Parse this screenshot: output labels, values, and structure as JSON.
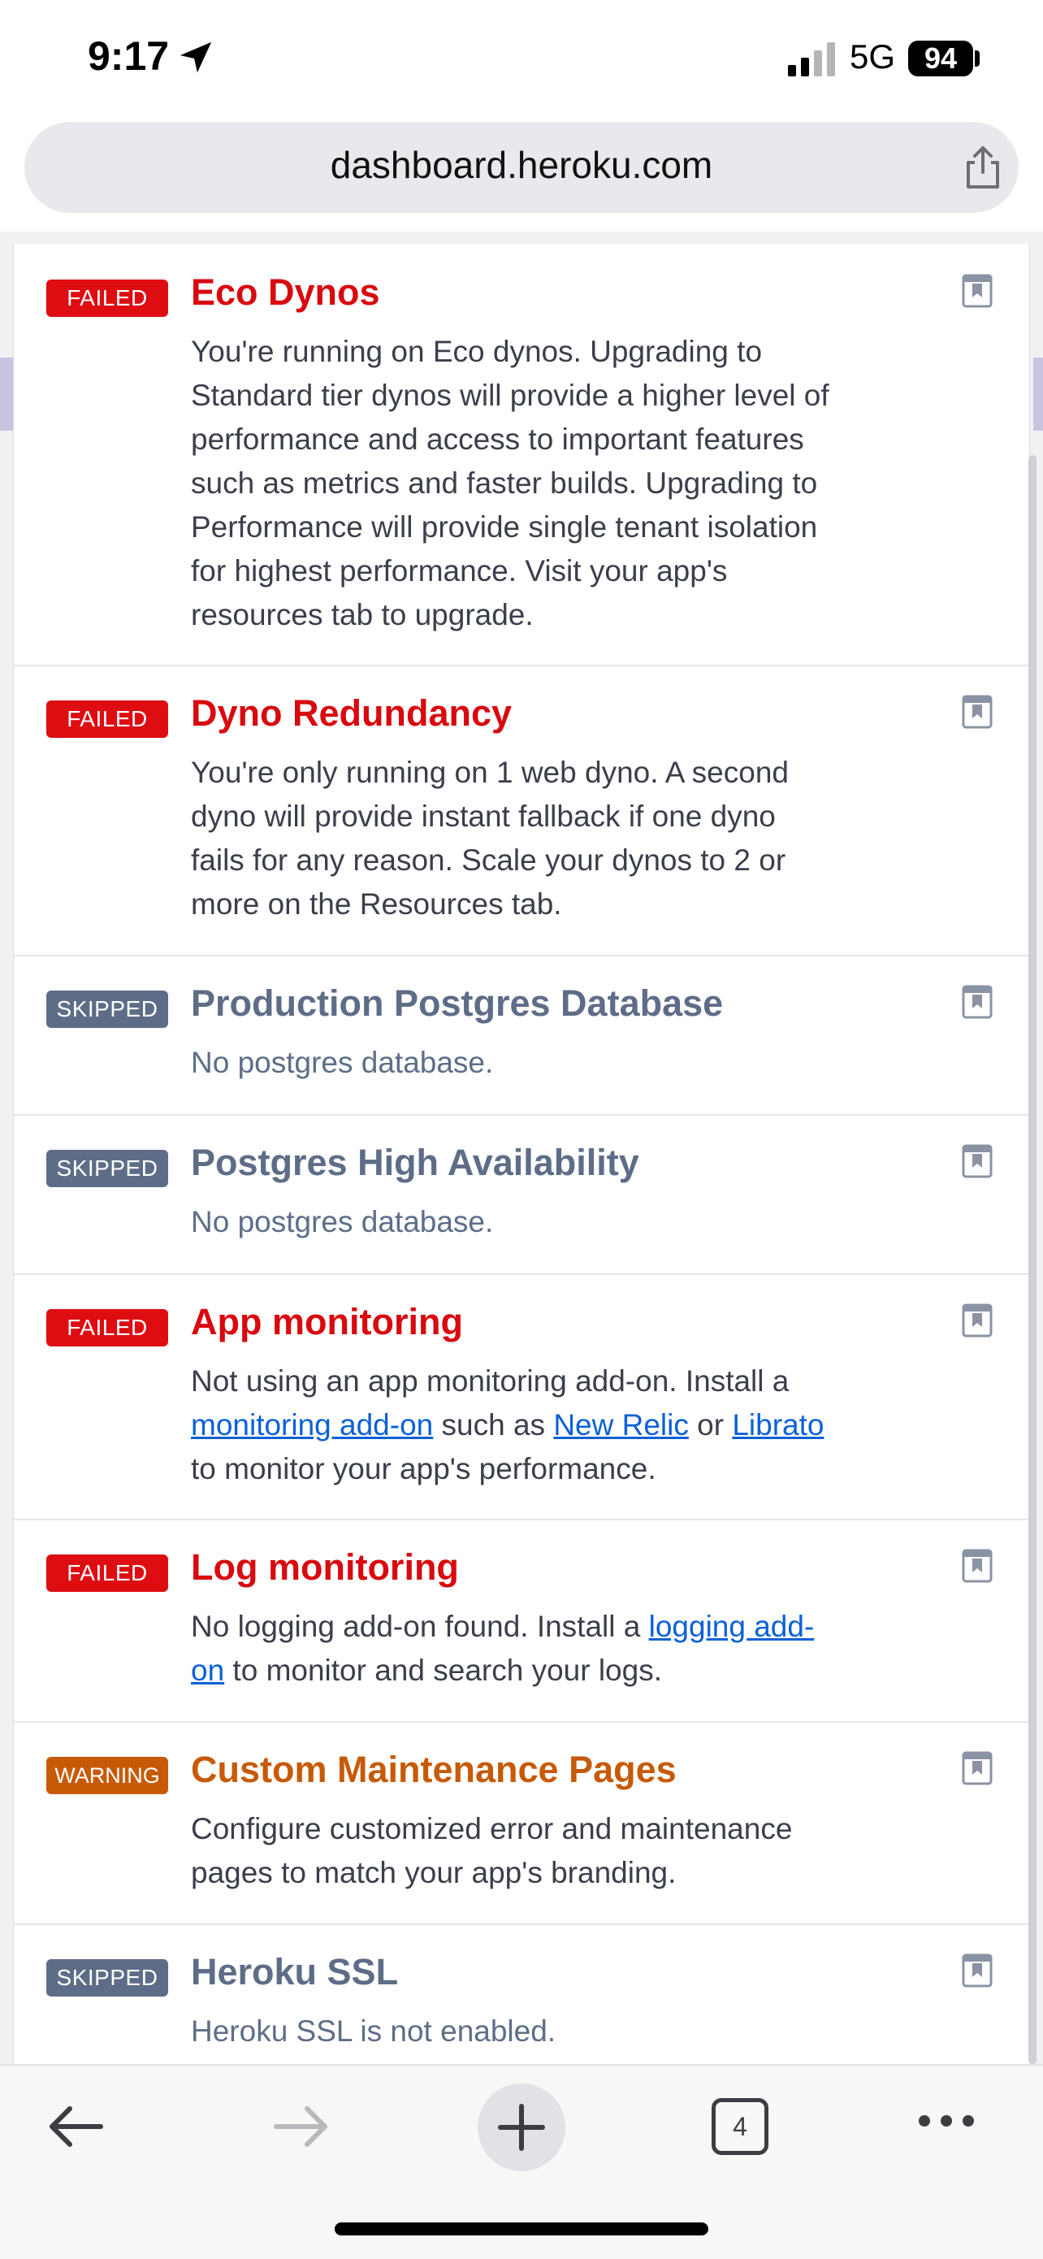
{
  "status_bar": {
    "time": "9:17",
    "network": "5G",
    "battery": "94"
  },
  "browser": {
    "url": "dashboard.heroku.com",
    "tab_count": "4"
  },
  "checks": [
    {
      "status": "FAILED",
      "title": "Eco Dynos",
      "lines": [
        "You're running on Eco dynos. Upgrading to",
        "Standard tier dynos will provide a higher level of",
        "performance and access to important features",
        "such as metrics and faster builds. Upgrading to",
        "Performance will provide single tenant isolation",
        "for highest performance. Visit your app's",
        "resources tab to upgrade."
      ]
    },
    {
      "status": "FAILED",
      "title": "Dyno Redundancy",
      "lines": [
        "You're only running on 1 web dyno. A second",
        "dyno will provide instant fallback if one dyno",
        "fails for any reason. Scale your dynos to 2 or",
        "more on the Resources tab."
      ]
    },
    {
      "status": "SKIPPED",
      "title": "Production Postgres Database",
      "lines": [
        "No postgres database."
      ]
    },
    {
      "status": "SKIPPED",
      "title": "Postgres High Availability",
      "lines": [
        "No postgres database."
      ]
    },
    {
      "status": "FAILED",
      "title": "App monitoring",
      "line1": "Not using an app monitoring add-on. Install a",
      "link1": "monitoring add-on",
      "text2": " such as ",
      "link2": "New Relic",
      "text3": " or ",
      "link3": "Librato",
      "line3": "to monitor your app's performance."
    },
    {
      "status": "FAILED",
      "title": "Log monitoring",
      "text1": "No logging add-on found. Install a ",
      "link1a": "logging add-",
      "link1b": "on",
      "text2": " to monitor and search your logs."
    },
    {
      "status": "WARNING",
      "title": "Custom Maintenance Pages",
      "lines": [
        "Configure customized error and maintenance",
        "pages to match your app's branding."
      ]
    },
    {
      "status": "SKIPPED",
      "title": "Heroku SSL",
      "lines": [
        "Heroku SSL is not enabled."
      ]
    }
  ],
  "colors": {
    "failed": "#dd0d12",
    "skipped": "#5e6d87",
    "warning": "#c75a06",
    "link": "#0a60d8"
  },
  "icons": [
    "location-arrow-icon",
    "signal-icon",
    "share-icon",
    "bookmark-icon",
    "back-arrow-icon",
    "forward-arrow-icon",
    "plus-icon",
    "tabs-icon",
    "more-icon"
  ]
}
